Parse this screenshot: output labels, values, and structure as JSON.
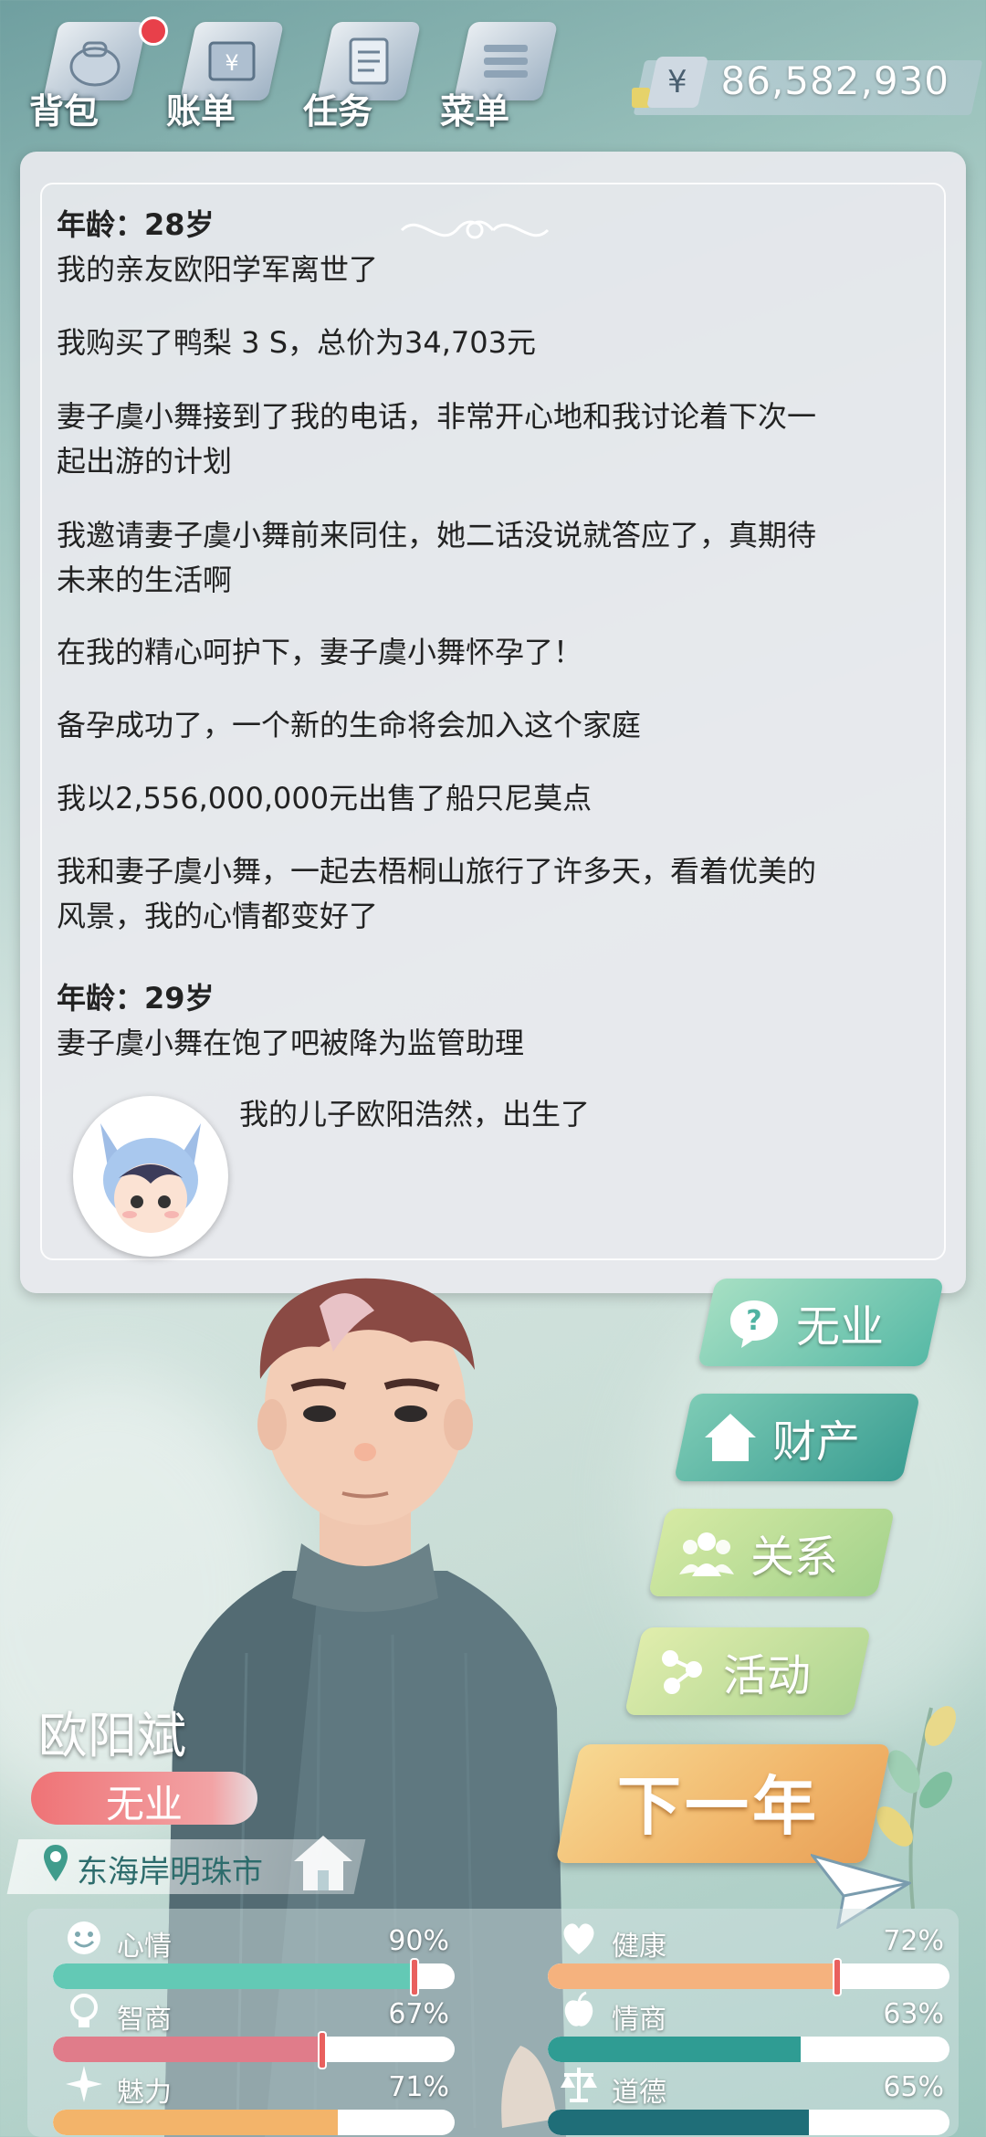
{
  "topbar": {
    "buttons": [
      {
        "label": "背包",
        "icon": "bag-icon"
      },
      {
        "label": "账单",
        "icon": "bill-icon"
      },
      {
        "label": "任务",
        "icon": "task-icon"
      },
      {
        "label": "菜单",
        "icon": "menu-icon"
      }
    ],
    "money_symbol": "¥",
    "money": "86,582,930"
  },
  "log": {
    "entries": [
      {
        "type": "age",
        "text": "年龄：28岁"
      },
      {
        "type": "event",
        "text": "我的亲友欧阳学军离世了"
      },
      {
        "type": "event",
        "text": "我购买了鸭梨 3 S，总价为34,703元"
      },
      {
        "type": "event",
        "text": "妻子虞小舞接到了我的电话，非常开心地和我讨论着下次一"
      },
      {
        "type": "event_cont",
        "text": "起出游的计划"
      },
      {
        "type": "event",
        "text": "我邀请妻子虞小舞前来同住，她二话没说就答应了，真期待"
      },
      {
        "type": "event_cont",
        "text": "未来的生活啊"
      },
      {
        "type": "event",
        "text": "在我的精心呵护下，妻子虞小舞怀孕了！"
      },
      {
        "type": "event",
        "text": "备孕成功了，一个新的生命将会加入这个家庭"
      },
      {
        "type": "event",
        "text": "我以2,556,000,000元出售了船只尼莫点"
      },
      {
        "type": "event",
        "text": "我和妻子虞小舞，一起去梧桐山旅行了许多天，看着优美的"
      },
      {
        "type": "event_cont",
        "text": "风景，我的心情都变好了"
      },
      {
        "type": "age",
        "text": "年龄：29岁"
      },
      {
        "type": "event",
        "text": "妻子虞小舞在饱了吧被降为监管助理"
      },
      {
        "type": "event_avatar",
        "text": "我的儿子欧阳浩然，出生了"
      }
    ]
  },
  "actions": {
    "job": {
      "label": "无业",
      "icon": "question-icon",
      "color_a": "#8fd3b6",
      "color_b": "#4fb3a2"
    },
    "assets": {
      "label": "财产",
      "icon": "house-icon",
      "color_a": "#6cc2ad",
      "color_b": "#3d9f94"
    },
    "relations": {
      "label": "关系",
      "icon": "people-icon",
      "color_a": "#cde49a",
      "color_b": "#9fcf8a"
    },
    "activity": {
      "label": "活动",
      "icon": "molecule-icon",
      "color_a": "#d8e8a2",
      "color_b": "#a9d48e"
    },
    "next_year": "下一年"
  },
  "character": {
    "name": "欧阳斌",
    "job": "无业",
    "location": "东海岸明珠市"
  },
  "stats": [
    {
      "key": "mood",
      "label": "心情",
      "value": "90%",
      "fill": 0.9,
      "icon": "smile-icon",
      "color": "#63c9b5",
      "marker": true
    },
    {
      "key": "health",
      "label": "健康",
      "value": "72%",
      "fill": 0.72,
      "icon": "heart-icon",
      "color": "#f5b27e",
      "marker": true
    },
    {
      "key": "iq",
      "label": "智商",
      "value": "67%",
      "fill": 0.67,
      "icon": "bulb-icon",
      "color": "#e07c8a",
      "marker": true
    },
    {
      "key": "eq",
      "label": "情商",
      "value": "63%",
      "fill": 0.63,
      "icon": "apple-icon",
      "color": "#2f9c93",
      "marker": false
    },
    {
      "key": "charm",
      "label": "魅力",
      "value": "71%",
      "fill": 0.71,
      "icon": "sparkle-icon",
      "color": "#f3b46a",
      "marker": false
    },
    {
      "key": "morality",
      "label": "道德",
      "value": "65%",
      "fill": 0.65,
      "icon": "scale-icon",
      "color": "#1f6e78",
      "marker": false
    }
  ]
}
